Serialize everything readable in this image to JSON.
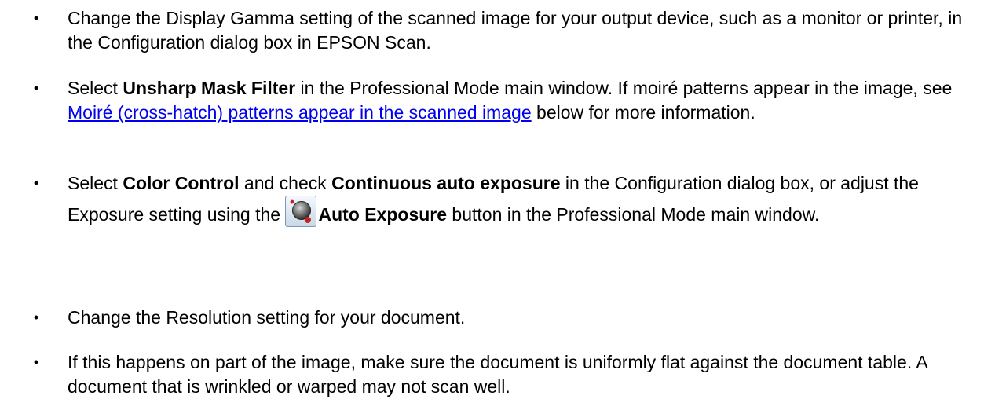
{
  "bullet_char": "•",
  "items": [
    {
      "text": "Change the Display Gamma setting of the scanned image for your output device, such as a monitor or printer, in the Configuration dialog box in EPSON Scan."
    },
    {
      "pre": "Select ",
      "bold1": "Unsharp Mask Filter",
      "mid": " in the Professional Mode main window. If moiré patterns appear in the image, see ",
      "link": "Moiré (cross-hatch) patterns appear in the scanned image",
      "post": "  below for more information."
    },
    {
      "pre": "Select ",
      "bold1": "Color Control",
      "mid1": " and check ",
      "bold2": "Continuous auto exposure",
      "mid2": " in the Configuration dialog box, or adjust the Exposure setting using the ",
      "button_label": "Auto Exposure",
      "button_icon": "auto-exposure-icon",
      "post": " button in the Professional Mode main window."
    },
    {
      "text": "Change the Resolution setting for your document."
    },
    {
      "text": "If this happens on part of the image, make sure the document is uniformly flat against the document table. A document that is wrinkled or warped may not scan well."
    }
  ],
  "colors": {
    "link": "#0000ee",
    "text": "#000000",
    "background": "#ffffff"
  }
}
